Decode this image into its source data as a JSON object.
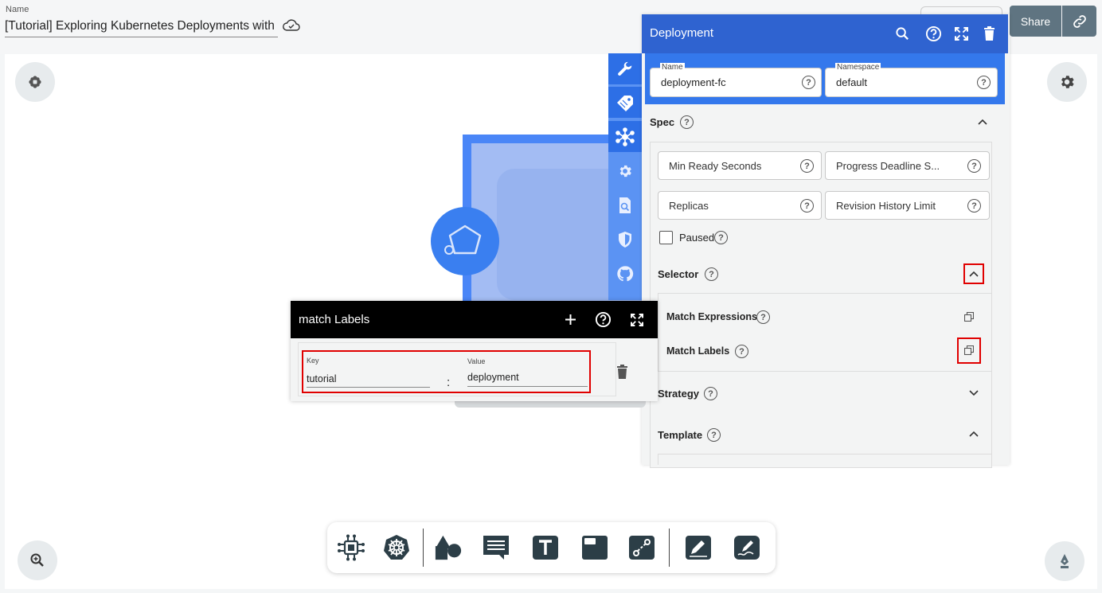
{
  "header": {
    "name_label": "Name",
    "design_name": "[Tutorial] Exploring Kubernetes Deployments with",
    "share_label": "Share"
  },
  "panel": {
    "title": "Deployment",
    "name_label": "Name",
    "name_value": "deployment-fc",
    "namespace_label": "Namespace",
    "namespace_value": "default",
    "spec_label": "Spec",
    "min_ready_seconds": "Min Ready Seconds",
    "progress_deadline": "Progress Deadline S...",
    "replicas": "Replicas",
    "revision_history_limit": "Revision History Limit",
    "paused": "Paused",
    "selector_label": "Selector",
    "match_expressions": "Match Expressions",
    "match_labels": "Match Labels",
    "strategy_label": "Strategy",
    "template_label": "Template"
  },
  "match_labels_popup": {
    "title": "match Labels",
    "key_label": "Key",
    "key_value": "tutorial",
    "separator": ":",
    "value_label": "Value",
    "value_value": "deployment"
  },
  "side_strip": {
    "items": [
      "wrench-icon",
      "tag-icon",
      "network-icon",
      "gear-icon",
      "search-doc-icon",
      "shield-icon",
      "github-icon"
    ]
  },
  "toolbar": {
    "items": [
      "component-icon",
      "kubernetes-icon",
      "shapes-icon",
      "comment-icon",
      "text-icon",
      "section-icon",
      "connector-icon",
      "pen-icon",
      "freehand-icon"
    ]
  },
  "colors": {
    "panel_header": "#2f63d0",
    "node_blue": "#4a86f7",
    "highlight_red": "#e00000",
    "share_button": "#5f7481"
  }
}
